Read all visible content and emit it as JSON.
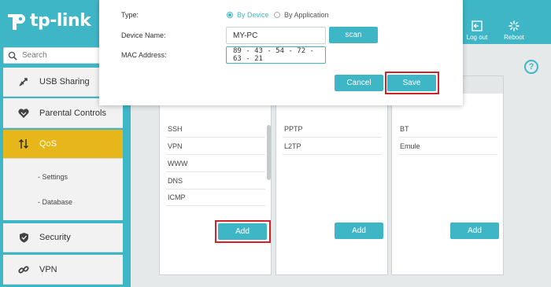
{
  "brand": {
    "name": "tp-link"
  },
  "top_actions": [
    {
      "label": "Log out",
      "icon": "logout-icon"
    },
    {
      "label": "Reboot",
      "icon": "reboot-icon"
    }
  ],
  "sidebar": {
    "search_placeholder": "Search",
    "items": [
      {
        "label": "USB Sharing",
        "icon": "usb-icon"
      },
      {
        "label": "Parental Controls",
        "icon": "parental-controls-icon"
      },
      {
        "label": "QoS",
        "icon": "qos-arrows-icon",
        "active": true
      },
      {
        "label": "Security",
        "icon": "shield-icon"
      },
      {
        "label": "VPN",
        "icon": "vpn-icon"
      }
    ],
    "submenu": [
      "- Settings",
      "- Database"
    ]
  },
  "panels": [
    {
      "services": [
        "SSH",
        "VPN",
        "WWW",
        "DNS",
        "ICMP"
      ],
      "add_label": "Add"
    },
    {
      "services": [
        "PPTP",
        "L2TP"
      ],
      "add_label": "Add"
    },
    {
      "services": [
        "BT",
        "Emule"
      ],
      "add_label": "Add"
    }
  ],
  "modal": {
    "type_label": "Type:",
    "type_options": [
      "By Device",
      "By Application"
    ],
    "type_selected": "By Device",
    "device_name_label": "Device Name:",
    "device_name_value": "MY-PC",
    "scan_label": "scan",
    "mac_label": "MAC Address:",
    "mac_value": "89 - 43 - 54 - 72 - 63 - 21",
    "cancel_label": "Cancel",
    "save_label": "Save"
  },
  "help_label": "?",
  "colors": {
    "accent": "#3fb6c6",
    "active_nav": "#e7b61a",
    "highlight": "#d0222b"
  }
}
